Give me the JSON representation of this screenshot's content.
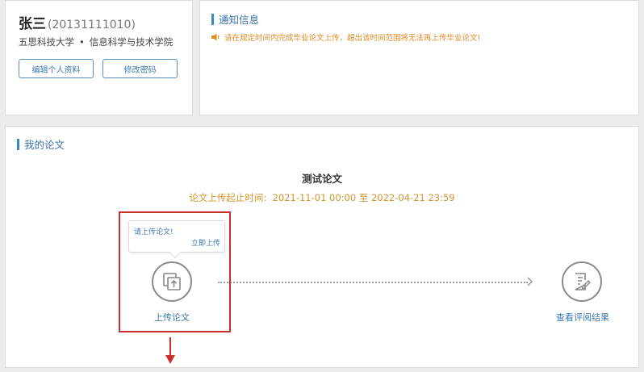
{
  "profile": {
    "name": "张三",
    "student_id": "(20131111010)",
    "university": "五思科技大学",
    "separator": "•",
    "college": "信息科学与技术学院",
    "edit_button": "编辑个人资料",
    "password_button": "修改密码"
  },
  "notice": {
    "title": "通知信息",
    "message": "请在规定时间内完成毕业论文上传，超出该时间范围将无法再上传毕业论文!",
    "message_icon": "speaker-icon"
  },
  "thesis": {
    "section_title": "我的论文",
    "title": "测试论文",
    "time_label": "论文上传起止时间:",
    "time_range": "2021-11-01 00:00 至 2022-04-21 23:59",
    "tooltip_text": "请上传论文!",
    "tooltip_link": "立即上传",
    "step_upload_label": "上传论文",
    "step_upload_icon": "upload-icon",
    "step_review_label": "查看评阅结果",
    "step_review_icon": "document-edit-icon"
  },
  "colors": {
    "accent": "#3a73ad",
    "warning": "#e08a21",
    "time": "#d2952f",
    "highlight": "#c9302c"
  }
}
